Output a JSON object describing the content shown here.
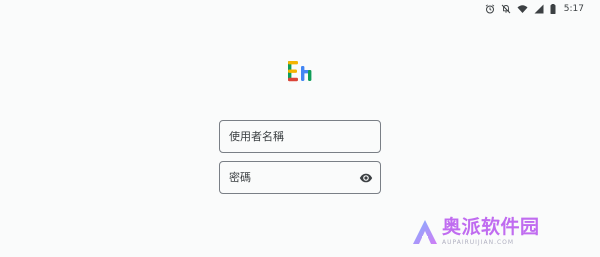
{
  "status_bar": {
    "time": "5:17",
    "icons": [
      "alarm-icon",
      "vibrate-off-icon",
      "wifi-icon",
      "signal-icon",
      "battery-icon"
    ]
  },
  "logo": {
    "name": "app-logo",
    "colors": [
      "#f4b400",
      "#0f9d58",
      "#db4437",
      "#4285f4"
    ]
  },
  "login": {
    "username_placeholder": "使用者名稱",
    "password_placeholder": "密碼"
  },
  "watermark": {
    "brand_name": "奥派软件园",
    "brand_domain": "AUPAIRUIJIAN.COM"
  }
}
